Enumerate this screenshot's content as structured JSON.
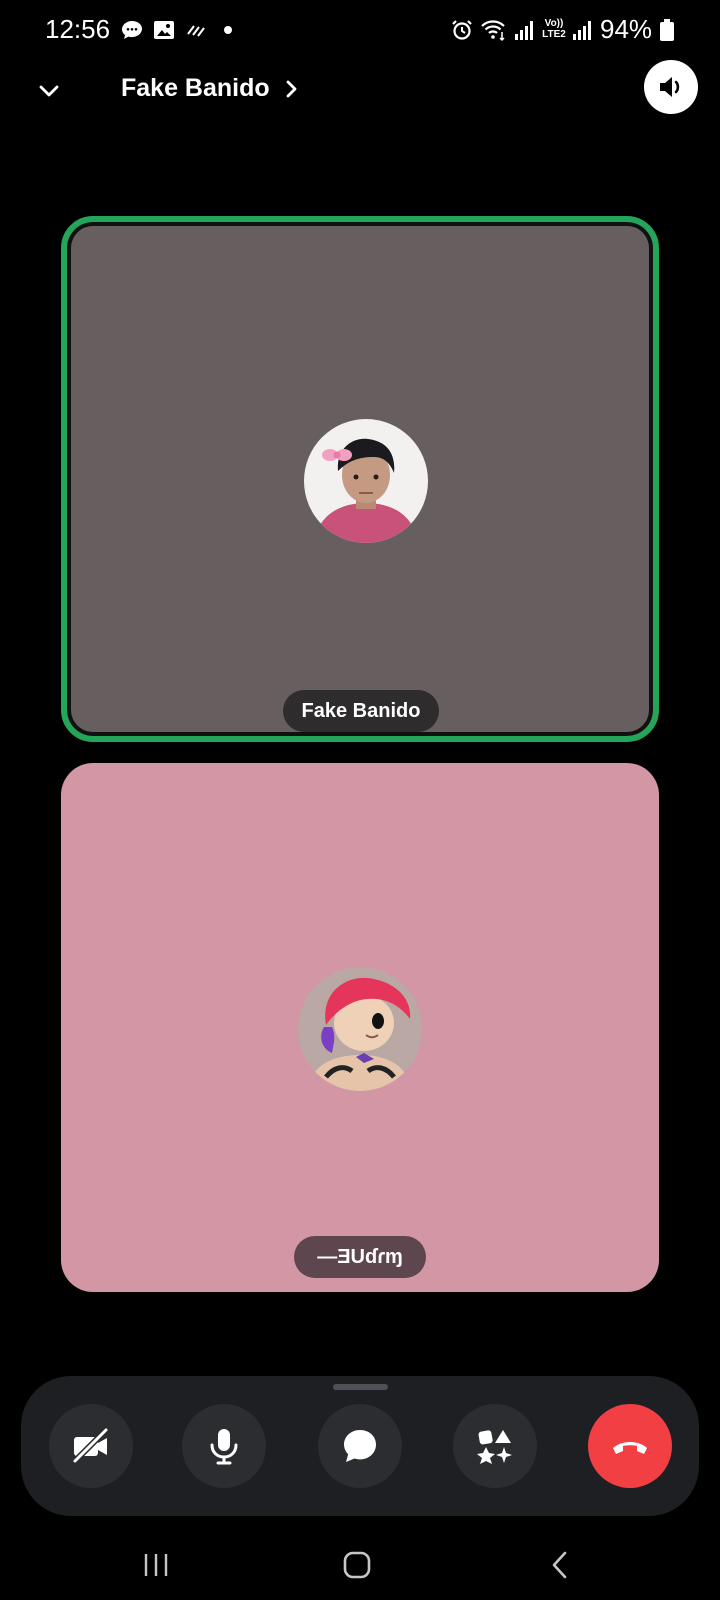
{
  "status_bar": {
    "time": "12:56",
    "battery_percent": "94%",
    "network_label_top": "Vo))",
    "network_label_bottom": "LTE2"
  },
  "header": {
    "title": "Fake Banido"
  },
  "tiles": [
    {
      "name": "Fake Banido",
      "background": "#675e5f",
      "speaking_border": "#23a55a"
    },
    {
      "name": "—ƎUɗɾɱ",
      "background": "#d396a5"
    }
  ],
  "controls": {
    "buttons": [
      "camera-off",
      "microphone",
      "chat",
      "activities",
      "end-call"
    ],
    "end_call_color": "#f23f43"
  },
  "colors": {
    "background": "#000000",
    "controls_tray": "#1e1f22",
    "control_button": "#2b2d31"
  }
}
